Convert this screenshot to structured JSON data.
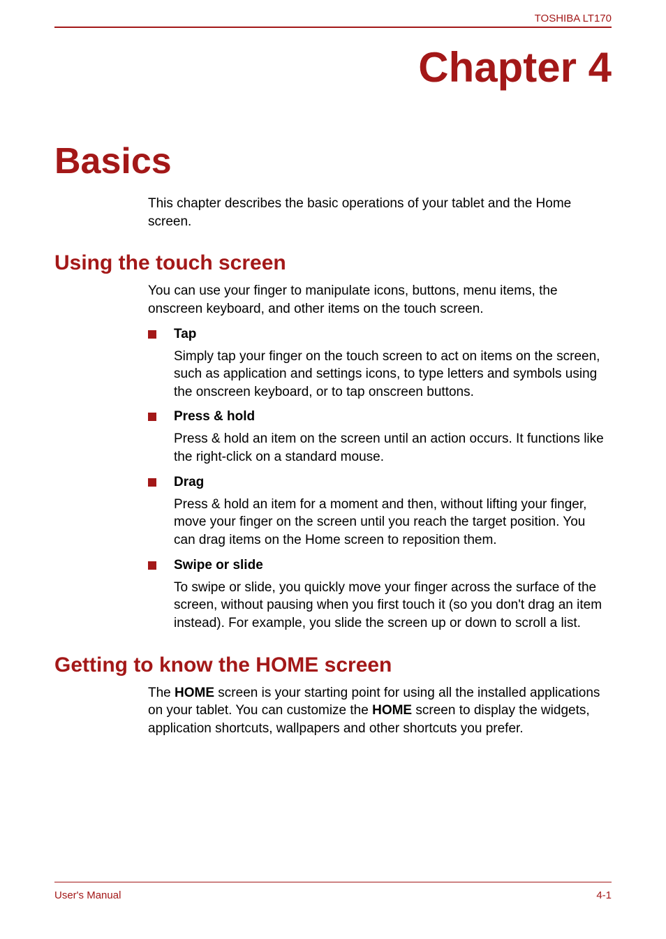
{
  "header": {
    "model": "TOSHIBA LT170"
  },
  "chapter": {
    "title": "Chapter 4",
    "heading": "Basics",
    "intro": "This chapter describes the basic operations of your tablet and the Home screen."
  },
  "sections": {
    "touch": {
      "heading": "Using the touch screen",
      "intro": "You can use your finger to manipulate icons, buttons, menu items, the onscreen keyboard, and other items on the touch screen.",
      "items": [
        {
          "label": "Tap",
          "body": "Simply tap your finger on the touch screen to act on items on the screen, such as application and settings icons, to type letters and symbols using the onscreen keyboard, or to tap onscreen buttons."
        },
        {
          "label": "Press & hold",
          "body": "Press & hold an item on the screen until an action occurs. It functions like the right-click on a standard mouse."
        },
        {
          "label": "Drag",
          "body": "Press & hold an item for a moment and then, without lifting your finger, move your finger on the screen until you reach the target position. You can drag items on the Home screen to reposition them."
        },
        {
          "label": "Swipe or slide",
          "body": "To swipe or slide, you quickly move your finger across the surface of the screen, without pausing when you first touch it (so you don't drag an item instead). For example, you slide the screen up or down to scroll a list."
        }
      ]
    },
    "home": {
      "heading": "Getting to know the HOME screen",
      "paragraph_parts": {
        "p1": "The ",
        "b1": "HOME",
        "p2": " screen is your starting point for using all the installed applications on your tablet. You can customize the ",
        "b2": "HOME",
        "p3": " screen to display the widgets, application shortcuts, wallpapers and other shortcuts you prefer."
      }
    }
  },
  "footer": {
    "left": "User's Manual",
    "right": "4-1"
  }
}
